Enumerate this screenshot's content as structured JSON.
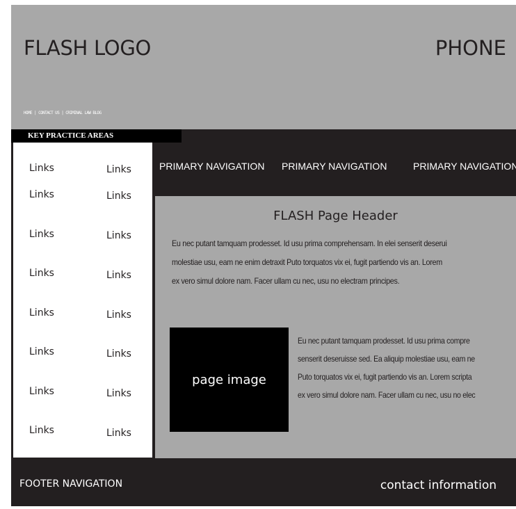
{
  "header": {
    "logo": "FLASH LOGO",
    "phone": "PHONE",
    "utility_links": "HOME | CONTACT US | CRIMINAL LAW BLOG"
  },
  "sidebar": {
    "title": "KEY PRACTICE AREAS",
    "links": [
      "Links",
      "Links",
      "Links",
      "Links",
      "Links",
      "Links",
      "Links",
      "Links",
      "Links",
      "Links",
      "Links",
      "Links",
      "Links",
      "Links",
      "Links",
      "Links"
    ]
  },
  "primary_nav": {
    "items": [
      "PRIMARY NAVIGATION",
      "PRIMARY NAVIGATION",
      "PRIMARY NAVIGATION"
    ]
  },
  "content": {
    "page_header": "FLASH Page Header",
    "paragraph_lines": [
      "Eu nec putant tamquam prodesset. Id usu prima comprehensam. In elei senserit deserui",
      "molestiae usu, eam ne enim detraxit Puto torquatos vix ei, fugit partiendo vis an. Lorem",
      "ex vero simul dolore nam. Facer ullam cu nec, usu no electram principes."
    ],
    "page_image_label": "page image",
    "side_paragraph_lines": [
      "Eu nec putant tamquam prodesset. Id usu prima compre",
      "senserit deseruisse sed. Ea aliquip molestiae usu, eam ne",
      "Puto torquatos vix ei, fugit partiendo vis an. Lorem scripta",
      "ex vero simul dolore nam. Facer ullam cu nec, usu no elec"
    ]
  },
  "footer": {
    "navigation": "FOOTER NAVIGATION",
    "contact": "contact information"
  }
}
